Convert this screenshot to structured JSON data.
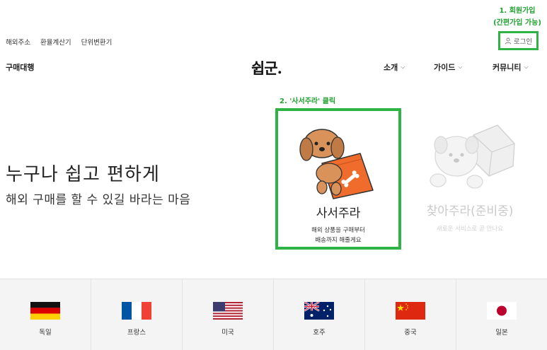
{
  "annotations": {
    "step1_line1": "1. 회원가입",
    "step1_line2": "(간편가입 가능)",
    "step2": "2. '사서주라' 클릭"
  },
  "top_links": [
    "해외주소",
    "환율계산기",
    "단위변환기"
  ],
  "login_label": "로그인",
  "brand_sub": "구매대행",
  "logo": "쉽군.",
  "nav": [
    {
      "label": "소개"
    },
    {
      "label": "가이드"
    },
    {
      "label": "커뮤니티"
    }
  ],
  "hero": {
    "title": "누구나 쉽고 편하게",
    "subtitle": "해외 구매를 할 수 있길 바라는 마음"
  },
  "services": [
    {
      "title": "사서주라",
      "desc_line1": "해외 상품을 구매부터",
      "desc_line2": "배송까지 해줄게요"
    },
    {
      "title": "찾아주라(준비중)",
      "desc_line1": "새로운 서비스로 곧 만나요",
      "desc_line2": ""
    }
  ],
  "countries": [
    {
      "name": "독일"
    },
    {
      "name": "프랑스"
    },
    {
      "name": "미국"
    },
    {
      "name": "호주"
    },
    {
      "name": "중국"
    },
    {
      "name": "일본"
    }
  ],
  "colors": {
    "highlight": "#2fb344",
    "annotation": "#1fa12e",
    "dog_fur": "#d9935a",
    "pillow": "#ef6c2c"
  }
}
